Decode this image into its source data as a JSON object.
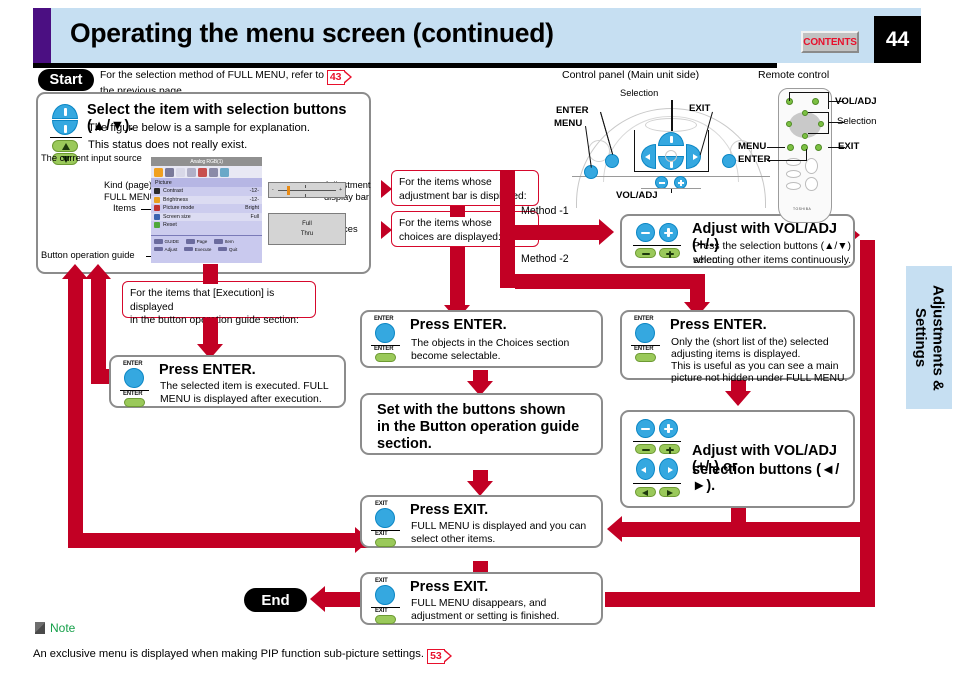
{
  "header": {
    "title": "Operating the menu screen (continued)",
    "contents_label": "CONTENTS",
    "page_number": "44"
  },
  "side_tab": {
    "label": "Adjustments &\nSettings"
  },
  "start": {
    "pill_label": "Start",
    "text_line1": "For the selection method of FULL MENU, refer to",
    "text_line2": "the previous page.",
    "page_ref": "43"
  },
  "end": {
    "pill_label": "End"
  },
  "step1": {
    "title": "Select the item with selection buttons (▲/▼).",
    "line1": "The figure below is a sample for explanation.",
    "line2": "This status does not really exist."
  },
  "osd_labels": {
    "input_source": "The current input source",
    "kind_line1": "Kind (page) of",
    "kind_line2": "FULL MENU",
    "items": "Items",
    "button_guide": "Button operation guide",
    "adjust_bar_line1": "Adjustment",
    "adjust_bar_line2": "display bar",
    "choices": "Choices"
  },
  "osd": {
    "source": "Analog RGB(1)",
    "page": "Picture",
    "rows": [
      {
        "name": "Contrast",
        "value": "-12-",
        "color": "#2b2b2b"
      },
      {
        "name": "Brightness",
        "value": "-12-",
        "color": "#e8a020"
      },
      {
        "name": "Picture mode",
        "value": "Bright",
        "color": "#c03030"
      },
      {
        "name": "Screen size",
        "value": "Full",
        "color": "#3a64b0"
      },
      {
        "name": "Reset",
        "value": "",
        "color": "#4fa83a"
      }
    ],
    "guide_row1": [
      "GUIDE",
      "Page",
      "Item"
    ],
    "guide_row2": [
      "Adjust",
      "Execute",
      "Quit"
    ],
    "adjust_bar": {
      "minus": "-",
      "plus": "+"
    },
    "choices": [
      "Full",
      "Thru"
    ]
  },
  "callouts": {
    "adjbar_line1": "For the items whose",
    "adjbar_line2": "adjustment bar is displayed:",
    "choices_line1": "For the items whose",
    "choices_line2": "choices are displayed:",
    "execution_line1": "For the items that [Execution] is displayed",
    "execution_line2": "in the button operation guide section:"
  },
  "methods": {
    "one": "Method -1",
    "two": "Method -2"
  },
  "enter_exec": {
    "button_top": "ENTER",
    "button_bottom": "ENTER",
    "title": "Press ENTER.",
    "line1": "The selected item is executed.  FULL",
    "line2": "MENU is displayed after execution."
  },
  "enter_choices": {
    "button_top": "ENTER",
    "button_bottom": "ENTER",
    "title": "Press ENTER.",
    "line1": "The objects in the Choices section",
    "line2": "become selectable."
  },
  "enter_method2": {
    "button_top": "ENTER",
    "button_bottom": "ENTER",
    "title": "Press ENTER.",
    "line1": "Only the (short list of the) selected",
    "line2": "adjusting items is displayed.",
    "line3": "This is useful as you can see a main",
    "line4": "picture not hidden under FULL MENU."
  },
  "set_buttons": {
    "line1": "Set with the buttons shown",
    "line2": "in the Button operation guide",
    "line3": "section."
  },
  "adjust_vol": {
    "title": "Adjust with VOL/ADJ (+/-)",
    "line1": "Press the selection buttons (▲/▼) when",
    "line2": "selecting other items continuously."
  },
  "adjust_vol_sel": {
    "line1": "Adjust with VOL/ADJ (+/-) or",
    "line2": "selection buttons (◄/►)."
  },
  "exit_back": {
    "button_top": "EXIT",
    "button_bottom": "EXIT",
    "title": "Press EXIT.",
    "line1": "FULL MENU is displayed and you can",
    "line2": "select other items."
  },
  "exit_end": {
    "button_top": "EXIT",
    "button_bottom": "EXIT",
    "title": "Press EXIT.",
    "line1": "FULL MENU disappears, and",
    "line2": "adjustment or setting is finished."
  },
  "control_panel": {
    "caption": "Control panel (Main unit side)",
    "selection": "Selection",
    "enter": "ENTER",
    "menu": "MENU",
    "exit": "EXIT",
    "voladj": "VOL/ADJ"
  },
  "remote": {
    "caption": "Remote control",
    "voladj": "VOL/ADJ",
    "selection": "Selection",
    "menu": "MENU",
    "enter": "ENTER",
    "exit": "EXIT",
    "brand": "TOSHIBA"
  },
  "note": {
    "title": "Note",
    "text": "An exclusive menu is displayed when making PIP function sub-picture settings.",
    "page_ref": "53"
  },
  "colors": {
    "header_band": "#c6dff2",
    "header_accent": "#4b0f82",
    "flow_red": "#c20024",
    "callout_red": "#d6082c",
    "contents_red": "#e8102c",
    "button_blue": "#35a8e0",
    "button_green": "#9ac95a",
    "note_green": "#16a04a"
  }
}
